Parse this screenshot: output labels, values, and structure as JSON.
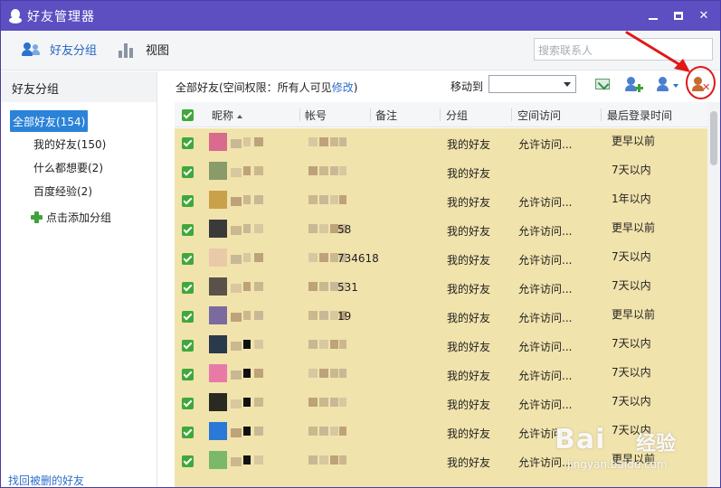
{
  "window": {
    "title": "好友管理器",
    "colors": {
      "titlebar": "#5d4ec1",
      "accent": "#2b83d8",
      "row_highlight": "#f1e3ac",
      "checkbox": "#40a83b",
      "annotation": "#e01818"
    }
  },
  "toolbar": {
    "friend_groups_label": "好友分组",
    "view_label": "视图",
    "search_placeholder": "搜索联系人"
  },
  "sidebar": {
    "header": "好友分组",
    "all_friends": "全部好友(154)",
    "groups": [
      {
        "label": "我的好友(150)"
      },
      {
        "label": "什么都想要(2)"
      },
      {
        "label": "百度经验(2)"
      }
    ],
    "add_group_label": "点击添加分组",
    "recover_link": "找回被删的好友"
  },
  "main": {
    "privacy_prefix": "全部好友(空间权限：所有人可见",
    "privacy_link": "修改",
    "privacy_suffix": ")",
    "move_to_label": "移动到",
    "move_to_value": "",
    "action_icons": [
      "send-message-icon",
      "add-friend-icon",
      "friend-settings-icon",
      "delete-friend-icon"
    ]
  },
  "table": {
    "columns": [
      "昵称",
      "帐号",
      "备注",
      "分组",
      "空间访问",
      "最后登录时间"
    ],
    "rows": [
      {
        "account_suffix": "",
        "group": "我的好友",
        "space_access": "允许访问...",
        "last_login": "更早以前"
      },
      {
        "account_suffix": "",
        "group": "我的好友",
        "space_access": "",
        "last_login": "7天以内"
      },
      {
        "account_suffix": "",
        "group": "我的好友",
        "space_access": "允许访问...",
        "last_login": "1年以内"
      },
      {
        "account_suffix": "58",
        "group": "我的好友",
        "space_access": "允许访问...",
        "last_login": "更早以前"
      },
      {
        "account_suffix": "734618",
        "group": "我的好友",
        "space_access": "允许访问...",
        "last_login": "7天以内"
      },
      {
        "account_suffix": "531",
        "group": "我的好友",
        "space_access": "允许访问...",
        "last_login": "7天以内"
      },
      {
        "account_suffix": "19",
        "group": "我的好友",
        "space_access": "允许访问...",
        "last_login": "更早以前"
      },
      {
        "account_suffix": "",
        "group": "我的好友",
        "space_access": "允许访问...",
        "last_login": "7天以内"
      },
      {
        "account_suffix": "",
        "group": "我的好友",
        "space_access": "允许访问...",
        "last_login": "7天以内"
      },
      {
        "account_suffix": "",
        "group": "我的好友",
        "space_access": "允许访问...",
        "last_login": "7天以内"
      },
      {
        "account_suffix": "",
        "group": "我的好友",
        "space_access": "允许访问...",
        "last_login": "7天以内"
      },
      {
        "account_suffix": "",
        "group": "我的好友",
        "space_access": "允许访问...",
        "last_login": "更早以前"
      }
    ]
  },
  "watermark": {
    "logo": "Bai",
    "logo2": "经验",
    "url": "jingyan.baidu.com"
  }
}
